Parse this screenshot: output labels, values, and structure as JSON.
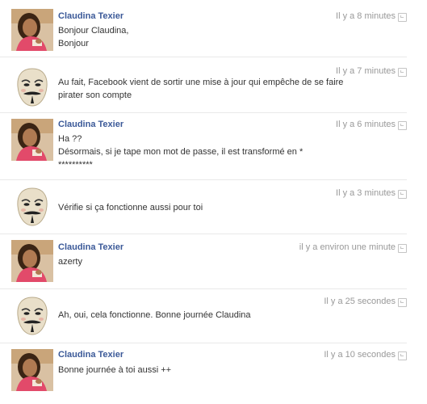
{
  "messages": [
    {
      "sender": "Claudina Texier",
      "avatar": "claudina",
      "time": "Il y a 8 minutes",
      "lines": [
        "Bonjour Claudina,",
        "Bonjour"
      ]
    },
    {
      "sender": "",
      "avatar": "anonymous-mask",
      "time": "Il y a 7 minutes",
      "lines": [
        "Au fait, Facebook vient de sortir une mise à jour qui empêche de se faire",
        "pirater son compte"
      ]
    },
    {
      "sender": "Claudina Texier",
      "avatar": "claudina",
      "time": "Il y a 6 minutes",
      "lines": [
        "Ha ??",
        "Désormais, si je tape mon mot de passe, il est transformé en *",
        "**********"
      ]
    },
    {
      "sender": "",
      "avatar": "anonymous-mask",
      "time": "Il y a 3 minutes",
      "lines": [
        "Vérifie si ça fonctionne aussi pour toi"
      ]
    },
    {
      "sender": "Claudina Texier",
      "avatar": "claudina",
      "time": "il y a environ une minute",
      "lines": [
        "azerty"
      ]
    },
    {
      "sender": "",
      "avatar": "anonymous-mask",
      "time": "Il y a 25 secondes",
      "lines": [
        "Ah, oui, cela fonctionne. Bonne journée Claudina"
      ]
    },
    {
      "sender": "Claudina Texier",
      "avatar": "claudina",
      "time": "Il y a 10 secondes",
      "lines": [
        "Bonne journée à toi aussi ++"
      ]
    }
  ],
  "colors": {
    "name": "#3b5998",
    "time": "#999999",
    "text": "#333333",
    "divider": "#e9e9e9"
  }
}
